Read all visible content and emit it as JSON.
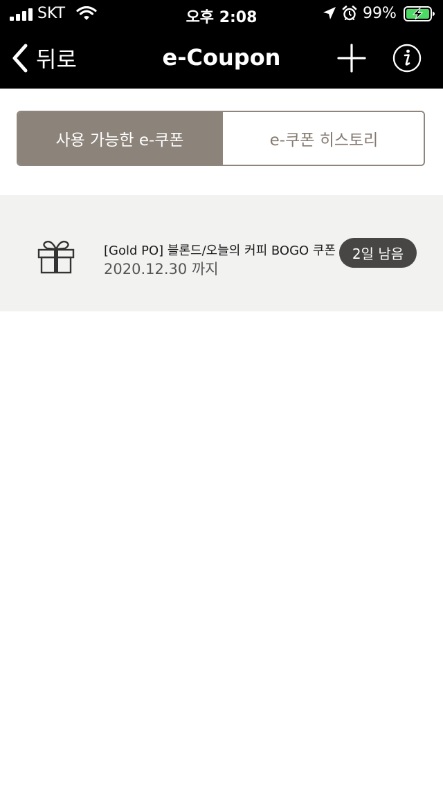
{
  "status_bar": {
    "carrier": "SKT",
    "time": "오후 2:08",
    "battery_percent": "99%",
    "icons": [
      "signal-icon",
      "wifi-icon",
      "location-icon",
      "alarm-icon",
      "battery-charging-icon"
    ]
  },
  "nav": {
    "back_label": "뒤로",
    "title": "e-Coupon",
    "icons": [
      "chevron-left-icon",
      "plus-icon",
      "info-icon"
    ]
  },
  "tabs": [
    {
      "label": "사용 가능한 e-쿠폰",
      "active": true
    },
    {
      "label": "e-쿠폰 히스토리",
      "active": false
    }
  ],
  "coupons": [
    {
      "icon": "gift-icon",
      "title": "[Gold PO] 블론드/오늘의 커피 BOGO 쿠폰",
      "expiry": "2020.12.30 까지",
      "badge": "2일 남음"
    }
  ],
  "colors": {
    "header_bg": "#000000",
    "segment_active_bg": "#8c837a",
    "segment_border": "#8e857c",
    "list_bg": "#f2f2f1",
    "badge_bg": "#474644"
  }
}
